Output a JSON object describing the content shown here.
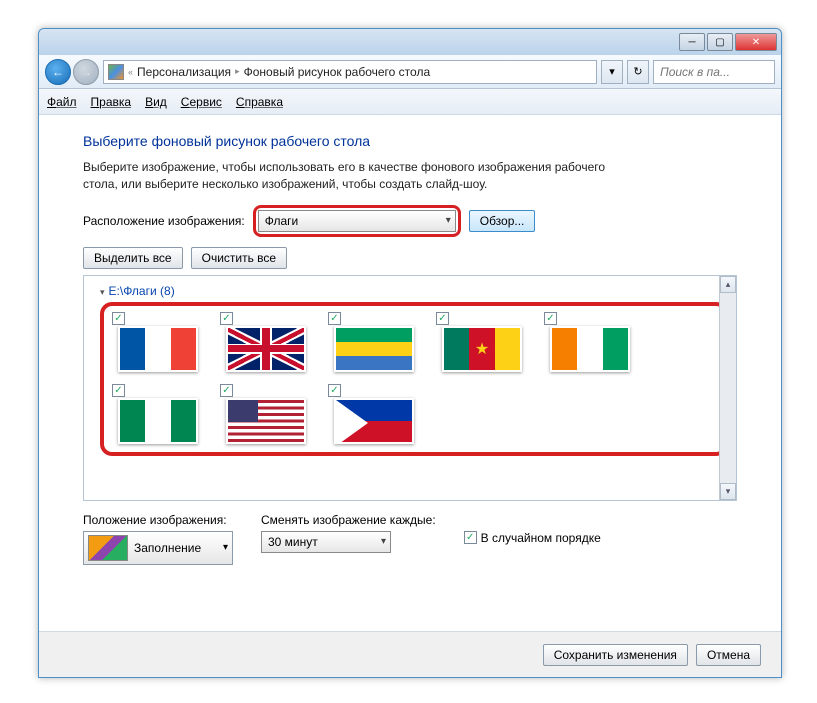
{
  "breadcrumb": {
    "item1": "Персонализация",
    "item2": "Фоновый рисунок рабочего стола"
  },
  "search": {
    "placeholder": "Поиск в па..."
  },
  "menu": {
    "file": "Файл",
    "edit": "Правка",
    "view": "Вид",
    "service": "Сервис",
    "help": "Справка"
  },
  "heading": "Выберите фоновый рисунок рабочего стола",
  "description": "Выберите изображение, чтобы использовать его в качестве фонового изображения рабочего стола, или выберите несколько изображений, чтобы создать слайд-шоу.",
  "locationLabel": "Расположение изображения:",
  "locationValue": "Флаги",
  "browse": "Обзор...",
  "selectAll": "Выделить все",
  "clearAll": "Очистить все",
  "folderLabel": "E:\\Флаги (8)",
  "position": {
    "label": "Положение изображения:",
    "value": "Заполнение"
  },
  "interval": {
    "label": "Сменять изображение каждые:",
    "value": "30 минут"
  },
  "shuffle": "В случайном порядке",
  "save": "Сохранить изменения",
  "cancel": "Отмена",
  "flags": [
    {
      "name": "france"
    },
    {
      "name": "uk"
    },
    {
      "name": "gabon"
    },
    {
      "name": "cameroon"
    },
    {
      "name": "ivory-coast"
    },
    {
      "name": "nigeria"
    },
    {
      "name": "usa"
    },
    {
      "name": "philippines"
    }
  ]
}
